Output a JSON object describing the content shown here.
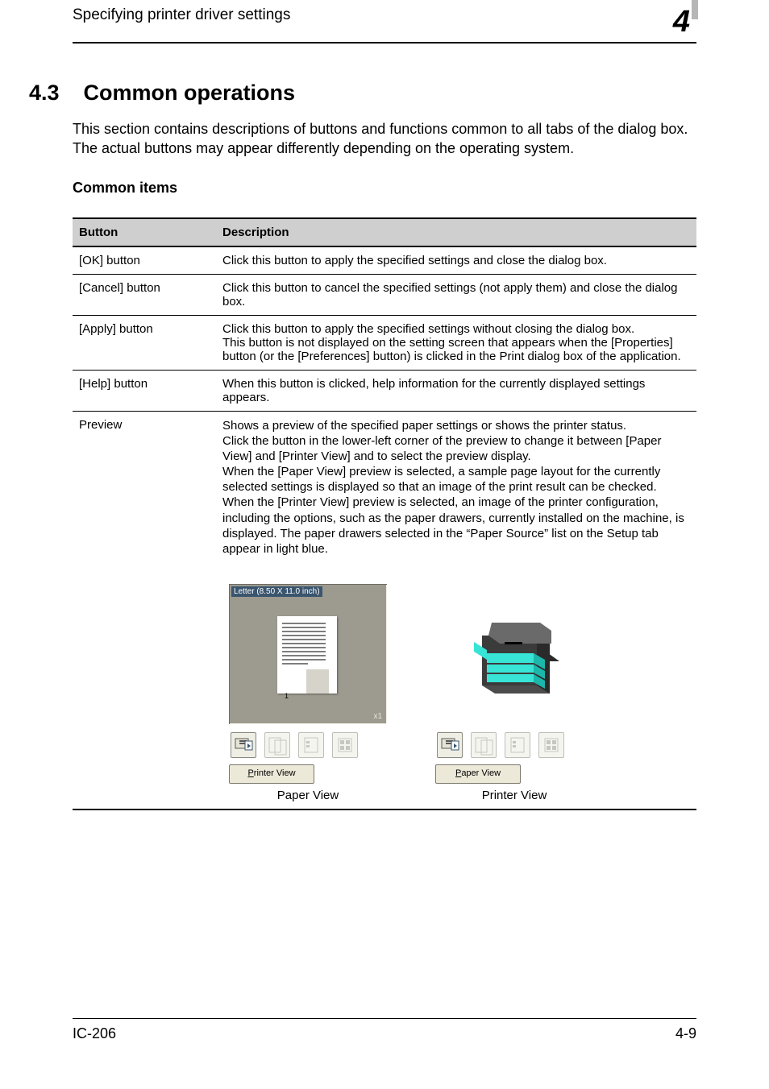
{
  "header": {
    "running_head": "Specifying printer driver settings",
    "chapter_digit": "4"
  },
  "section": {
    "number": "4.3",
    "title": "Common operations",
    "intro": "This section contains descriptions of buttons and functions common to all tabs of the dialog box. The actual buttons may appear differently depending on the operating system.",
    "subtitle": "Common items"
  },
  "table": {
    "head": {
      "button": "Button",
      "description": "Description"
    },
    "rows": [
      {
        "button": "[OK] button",
        "desc": "Click this button to apply the specified settings and close the dialog box."
      },
      {
        "button": "[Cancel] button",
        "desc": "Click this button to cancel the specified settings (not apply them) and close the dialog box."
      },
      {
        "button": "[Apply] button",
        "desc": "Click this button to apply the specified settings without closing the dialog box.\nThis button is not displayed on the setting screen that appears when the [Properties] button (or the [Preferences] button) is clicked in the Print dialog box of the application."
      },
      {
        "button": "[Help] button",
        "desc": "When this button is clicked, help information for the currently displayed settings appears."
      },
      {
        "button": "Preview",
        "desc": "Shows a preview of the specified paper settings or shows the printer status.\nClick the button in the lower-left corner of the preview to change it between [Paper View] and [Printer View] and to select the preview display.\nWhen the [Paper View] preview is selected, a sample page layout for the currently selected settings is displayed so that an image of the print result can be checked.\nWhen the [Printer View] preview is selected, an image of the printer configuration, including the options, such as the paper drawers, currently installed on the machine, is displayed. The paper drawers selected in the “Paper Source” list on the Setup tab appear in light blue."
      }
    ]
  },
  "paperview": {
    "size_label": "Letter (8.50 X 11.0 inch)",
    "zoom_label": "x1",
    "button_label": "Printer View",
    "button_accelerator": "P",
    "caption": "Paper View"
  },
  "printerview": {
    "button_label": "Paper View",
    "button_accelerator": "P",
    "caption": "Printer View"
  },
  "footer": {
    "model": "IC-206",
    "page": "4-9"
  }
}
